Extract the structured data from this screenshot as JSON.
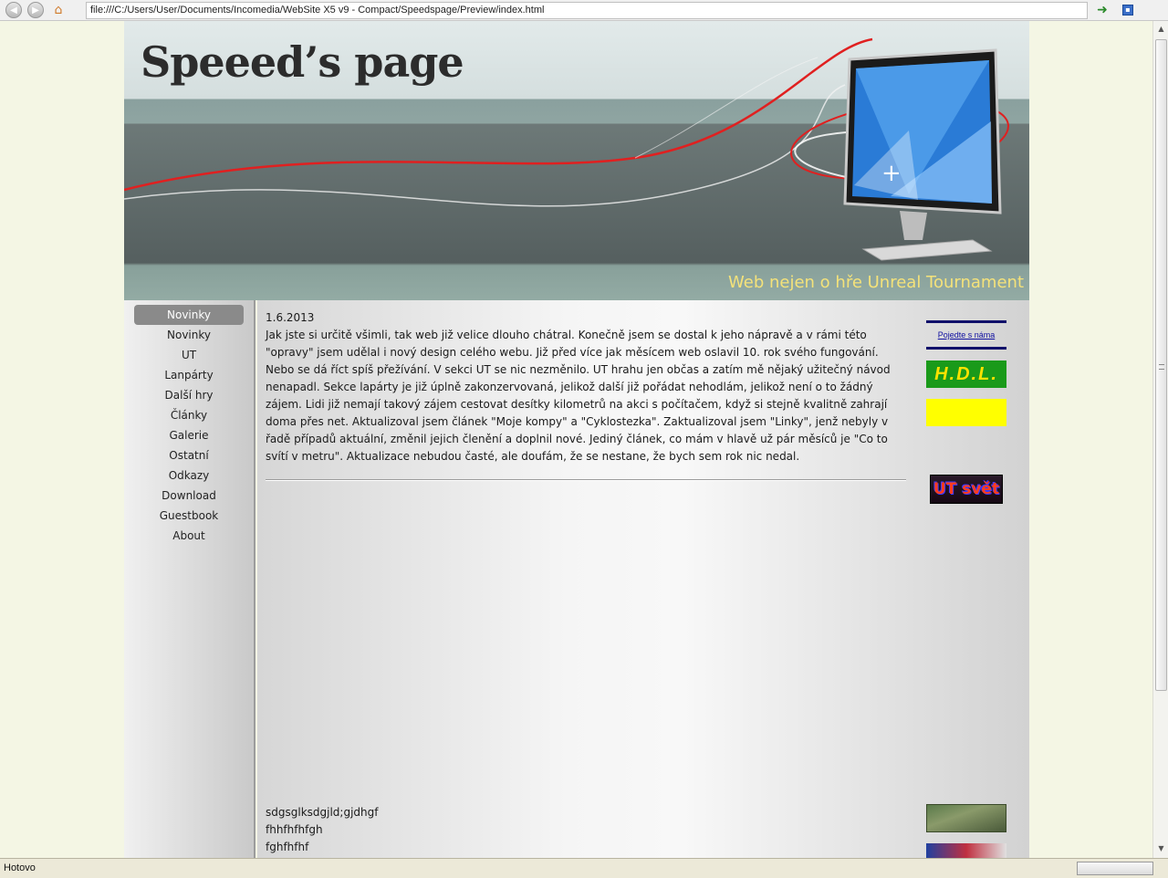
{
  "browser": {
    "address": "file:///C:/Users/User/Documents/Incomedia/WebSite X5 v9 - Compact/Speedspage/Preview/index.html",
    "status": "Hotovo"
  },
  "site": {
    "title": "Speeed’s page",
    "tagline": "Web nejen o hře Unreal Tournament"
  },
  "menu": [
    {
      "label": "Novinky",
      "active": true
    },
    {
      "label": "Novinky"
    },
    {
      "label": "UT"
    },
    {
      "label": "Lanpárty"
    },
    {
      "label": "Další hry"
    },
    {
      "label": "Články"
    },
    {
      "label": "Galerie"
    },
    {
      "label": "Ostatní"
    },
    {
      "label": "Odkazy"
    },
    {
      "label": "Download"
    },
    {
      "label": "Guestbook"
    },
    {
      "label": "About"
    }
  ],
  "article": {
    "date": "1.6.2013",
    "body": "Jak jste si určitě všimli, tak web již velice dlouho chátral. Konečně jsem se dostal k jeho nápravě a v rámi této \"opravy\" jsem udělal i nový design celého webu. Již před více jak měsícem web oslavil 10. rok svého fungování. Nebo se dá říct spíš přežívání. V sekci UT se nic nezměnilo. UT hrahu jen občas a zatím mě nějaký užitečný návod nenapadl. Sekce lapárty je již úplně zakonzervovaná, jelikož další již pořádat nehodlám, jelikož není o to žádný zájem. Lidi již nemají takový zájem cestovat desítky kilometrů na akci s počítačem, když si stejně kvalitně zahrají doma přes net. Aktualizoval jsem článek \"Moje kompy\" a \"Cyklostezka\".  Zaktualizoval jsem \"Linky\", jenž nebyly v řadě případů aktuální, změnil jejich členění a doplnil nové. Jediný článek, co mám v hlavě už pár měsíců je \"Co to svítí v metru\". Aktualizace nebudou časté, ale doufám, že se nestane, že bych sem rok nic nedal."
  },
  "bottom_lines": [
    "sdgsglksdgjld;gjdhgf",
    "fhhfhfhfgh",
    "fghfhfhf"
  ],
  "banners": {
    "link_label": "Pojedte s náma",
    "hdl_label": "H.D.L.",
    "ut_label": "UT svět"
  }
}
